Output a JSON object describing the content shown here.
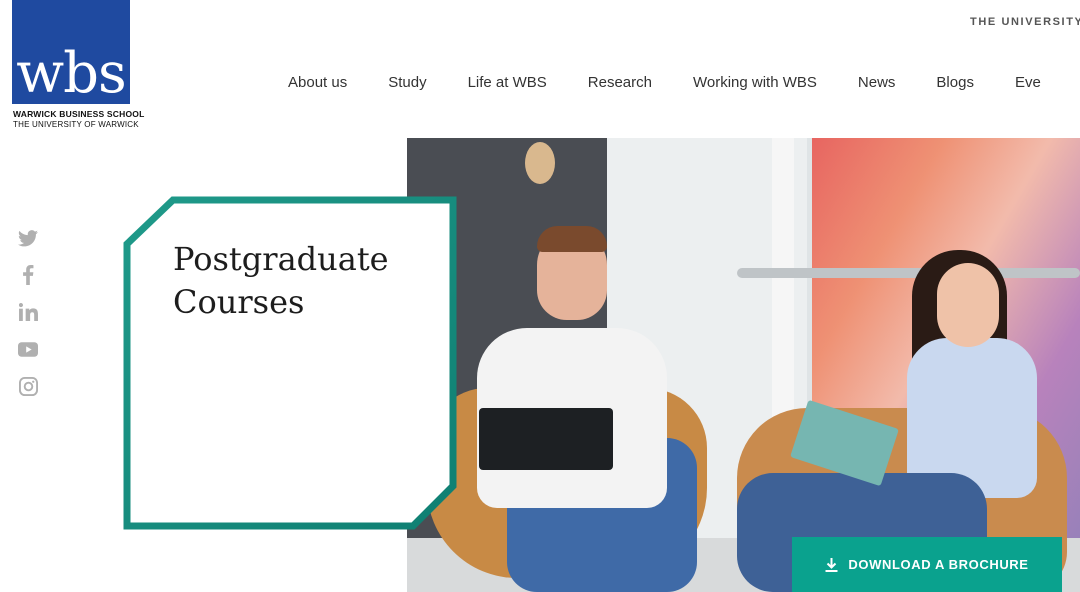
{
  "brand": {
    "logo_text": "wbs",
    "school_name": "WARWICK BUSINESS SCHOOL",
    "university": "THE UNIVERSITY OF WARWICK",
    "color": "#1f4aa0"
  },
  "utility": {
    "university_link": "THE UNIVERSITY O"
  },
  "nav": {
    "items": [
      {
        "label": "About us"
      },
      {
        "label": "Study"
      },
      {
        "label": "Life at WBS"
      },
      {
        "label": "Research"
      },
      {
        "label": "Working with WBS"
      },
      {
        "label": "News"
      },
      {
        "label": "Blogs"
      },
      {
        "label": "Eve"
      }
    ]
  },
  "social": {
    "icons": [
      "twitter-icon",
      "facebook-icon",
      "linkedin-icon",
      "youtube-icon",
      "instagram-icon"
    ],
    "color": "#b0b0b0"
  },
  "hero": {
    "title_line1": "Postgraduate",
    "title_line2": "Courses",
    "frame_colors": [
      "#1f9a8a",
      "#0f7f72"
    ]
  },
  "cta": {
    "label": "DOWNLOAD A BROCHURE",
    "icon": "download-icon",
    "color": "#0aa28e"
  }
}
